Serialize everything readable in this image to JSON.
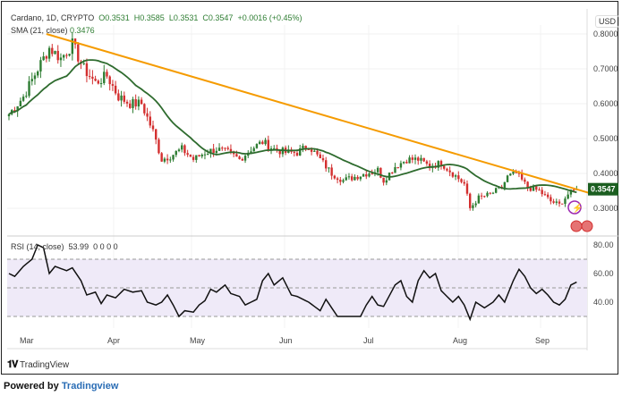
{
  "header": {
    "symbol": "Cardano, 1D, CRYPTO",
    "open": "O0.3531",
    "high": "H0.3585",
    "low": "L0.3531",
    "close": "C0.3547",
    "change": "+0.0016 (+0.45%)",
    "sma_label": "SMA (21, close)",
    "sma_value": "0.3476",
    "rsi_label": "RSI (14, close)",
    "rsi_value": "53.99",
    "rsi_extra": "0 0 0 0"
  },
  "currency": "USD",
  "last_price": "0.3547",
  "branding": {
    "logo_text": "TradingView",
    "powered_prefix": "Powered by",
    "powered_link": "Tradingview"
  },
  "colors": {
    "up": "#2e7d32",
    "down": "#d32f2f",
    "sma": "#2e6b2e",
    "trend": "#f59b00",
    "rsi": "#111111",
    "rsi_band": "#efeaf8"
  },
  "chart_data": [
    {
      "type": "candlestick",
      "title": "Cardano, 1D",
      "ylabel": "USD",
      "ylim": [
        0.24,
        0.82
      ],
      "yticks": [
        "0.8000",
        "0.7000",
        "0.6000",
        "0.5000",
        "0.4000",
        "0.3000"
      ],
      "xticks": [
        "Mar",
        "Apr",
        "May",
        "Jun",
        "Jul",
        "Aug",
        "Sep"
      ],
      "close_keypoints_day_value": [
        [
          0,
          0.57
        ],
        [
          5,
          0.62
        ],
        [
          10,
          0.7
        ],
        [
          14,
          0.76
        ],
        [
          18,
          0.73
        ],
        [
          22,
          0.77
        ],
        [
          26,
          0.7
        ],
        [
          30,
          0.66
        ],
        [
          34,
          0.68
        ],
        [
          38,
          0.62
        ],
        [
          42,
          0.6
        ],
        [
          46,
          0.6
        ],
        [
          50,
          0.52
        ],
        [
          53,
          0.44
        ],
        [
          56,
          0.45
        ],
        [
          60,
          0.47
        ],
        [
          64,
          0.44
        ],
        [
          68,
          0.46
        ],
        [
          72,
          0.47
        ],
        [
          76,
          0.46
        ],
        [
          80,
          0.44
        ],
        [
          84,
          0.47
        ],
        [
          88,
          0.49
        ],
        [
          92,
          0.47
        ],
        [
          96,
          0.46
        ],
        [
          100,
          0.46
        ],
        [
          104,
          0.48
        ],
        [
          108,
          0.44
        ],
        [
          112,
          0.4
        ],
        [
          116,
          0.38
        ],
        [
          120,
          0.39
        ],
        [
          124,
          0.4
        ],
        [
          128,
          0.41
        ],
        [
          130,
          0.38
        ],
        [
          134,
          0.42
        ],
        [
          138,
          0.44
        ],
        [
          142,
          0.44
        ],
        [
          146,
          0.42
        ],
        [
          150,
          0.43
        ],
        [
          154,
          0.4
        ],
        [
          158,
          0.37
        ],
        [
          160,
          0.3
        ],
        [
          163,
          0.33
        ],
        [
          167,
          0.34
        ],
        [
          171,
          0.36
        ],
        [
          173,
          0.39
        ],
        [
          176,
          0.4
        ],
        [
          180,
          0.36
        ],
        [
          184,
          0.35
        ],
        [
          188,
          0.32
        ],
        [
          191,
          0.31
        ],
        [
          194,
          0.34
        ],
        [
          197,
          0.3547
        ]
      ],
      "sma": {
        "name": "SMA (21, close)",
        "last": 0.3476
      },
      "trendline": {
        "from": [
          13,
          0.8
        ],
        "to": [
          203,
          0.34
        ]
      },
      "last": 0.3547
    },
    {
      "type": "line",
      "title": "RSI (14, close)",
      "ylim": [
        20,
        85
      ],
      "yticks": [
        "80.00",
        "60.00",
        "40.00"
      ],
      "bands": [
        30,
        70
      ],
      "mid": 50,
      "keypoints_day_value": [
        [
          0,
          60
        ],
        [
          2,
          58
        ],
        [
          5,
          65
        ],
        [
          8,
          70
        ],
        [
          10,
          80
        ],
        [
          12,
          78
        ],
        [
          14,
          60
        ],
        [
          16,
          65
        ],
        [
          20,
          62
        ],
        [
          22,
          64
        ],
        [
          25,
          55
        ],
        [
          27,
          45
        ],
        [
          30,
          47
        ],
        [
          32,
          39
        ],
        [
          34,
          45
        ],
        [
          37,
          43
        ],
        [
          40,
          49
        ],
        [
          43,
          47
        ],
        [
          46,
          48
        ],
        [
          48,
          40
        ],
        [
          51,
          38
        ],
        [
          53,
          40
        ],
        [
          55,
          45
        ],
        [
          57,
          38
        ],
        [
          59,
          30
        ],
        [
          61,
          34
        ],
        [
          64,
          33
        ],
        [
          66,
          38
        ],
        [
          68,
          41
        ],
        [
          70,
          49
        ],
        [
          72,
          47
        ],
        [
          75,
          52
        ],
        [
          77,
          46
        ],
        [
          80,
          44
        ],
        [
          82,
          38
        ],
        [
          86,
          42
        ],
        [
          88,
          55
        ],
        [
          90,
          60
        ],
        [
          92,
          52
        ],
        [
          95,
          57
        ],
        [
          98,
          45
        ],
        [
          100,
          44
        ],
        [
          104,
          40
        ],
        [
          108,
          34
        ],
        [
          110,
          42
        ],
        [
          114,
          30
        ],
        [
          118,
          30
        ],
        [
          122,
          30
        ],
        [
          124,
          38
        ],
        [
          126,
          44
        ],
        [
          128,
          38
        ],
        [
          130,
          37
        ],
        [
          134,
          52
        ],
        [
          136,
          55
        ],
        [
          138,
          44
        ],
        [
          140,
          40
        ],
        [
          142,
          55
        ],
        [
          144,
          62
        ],
        [
          146,
          57
        ],
        [
          148,
          60
        ],
        [
          150,
          48
        ],
        [
          154,
          40
        ],
        [
          156,
          44
        ],
        [
          158,
          38
        ],
        [
          160,
          28
        ],
        [
          162,
          40
        ],
        [
          165,
          36
        ],
        [
          168,
          40
        ],
        [
          170,
          45
        ],
        [
          172,
          40
        ],
        [
          175,
          55
        ],
        [
          177,
          63
        ],
        [
          179,
          58
        ],
        [
          181,
          50
        ],
        [
          183,
          46
        ],
        [
          185,
          49
        ],
        [
          187,
          45
        ],
        [
          189,
          40
        ],
        [
          191,
          38
        ],
        [
          193,
          42
        ],
        [
          195,
          52
        ],
        [
          197,
          54
        ]
      ]
    }
  ]
}
